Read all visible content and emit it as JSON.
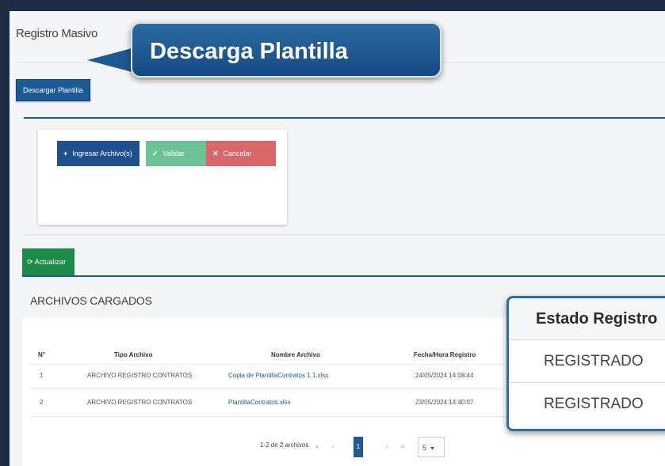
{
  "page": {
    "title": "Registro Masivo"
  },
  "toolbar": {
    "download_label": "Descargar Plantilla"
  },
  "upload": {
    "ingresar_label": "Ingresar Archivo(s)",
    "validar_label": "Validar",
    "cancelar_label": "Cancelar"
  },
  "tabs": {
    "refresh_label": "Actualizar"
  },
  "table": {
    "title": "ARCHIVOS CARGADOS",
    "columns": [
      "N°",
      "Tipo Archivo",
      "Nombre Archivo",
      "Fecha/Hora Registro"
    ],
    "rows": [
      {
        "num": "1",
        "tipo": "ARCHIVO REGISTRO CONTRATOS",
        "nombre": "Copia de PlantillaContratos 1 1.xlsx",
        "fecha": "24/05/2024 14:08:44"
      },
      {
        "num": "2",
        "tipo": "ARCHIVO REGISTRO CONTRATOS",
        "nombre": "PlantillaContratos.xlsx",
        "fecha": "23/05/2024 14:40:07"
      }
    ]
  },
  "pagination": {
    "info": "1-2 de 2 archivos",
    "first": "«",
    "prev": "‹",
    "current": "1",
    "next": "›",
    "last": "»",
    "page_size": "5"
  },
  "callouts": {
    "download": "Descarga Plantilla",
    "estado_header": "Estado Registro",
    "estado_values": [
      "REGISTRADO",
      "REGISTRADO"
    ]
  },
  "colors": {
    "primary": "#1f5c91",
    "success": "#6cc296",
    "danger": "#d9676a",
    "refresh": "#1b8a4a"
  }
}
